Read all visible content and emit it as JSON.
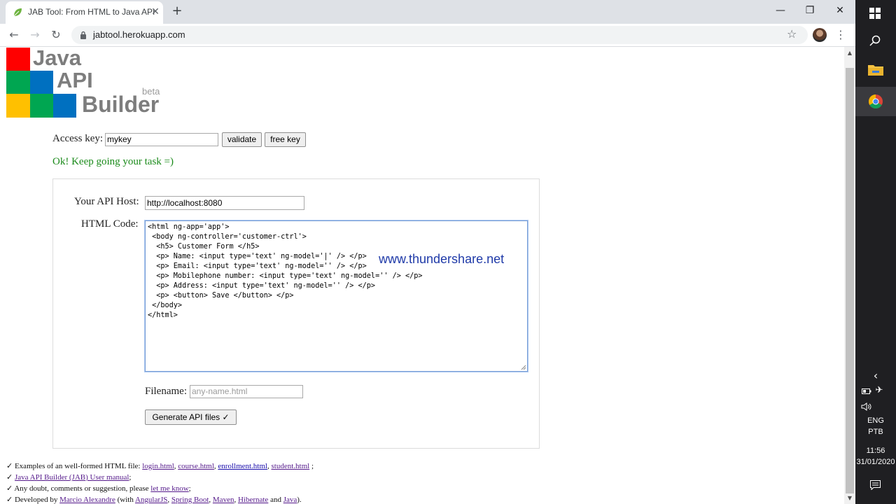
{
  "browser": {
    "tab_title": "JAB Tool: From HTML to Java API",
    "tab_close": "✕",
    "new_tab": "+",
    "url": "jabtool.herokuapp.com",
    "controls": {
      "minimize": "—",
      "restore": "❐",
      "close": "✕"
    },
    "nav": {
      "back": "←",
      "forward": "→",
      "reload": "↻"
    },
    "bookmark_star": "☆",
    "menu": "⋮"
  },
  "logo": {
    "line1": "Java",
    "line2": "API",
    "line3": "Builder",
    "beta": "beta",
    "colors": [
      "#ff0000",
      "#ffffff",
      "#00a651",
      "#0070c0",
      "#ffc000",
      "#00a651",
      "#0070c0"
    ]
  },
  "access": {
    "label": "Access key:",
    "value": "mykey",
    "validate_label": "validate",
    "free_key_label": "free key",
    "status": "Ok! Keep going your task =)"
  },
  "form": {
    "host_label": "Your API Host:",
    "host_value": "http://localhost:8080",
    "code_label": "HTML Code:",
    "code_lines": [
      "<html ng-app='app'>",
      " <body ng-controller='customer-ctrl'>",
      "  <h5> Customer Form </h5>",
      "  <p> Name: <input type='text' ng-model='|' /> </p>",
      "  <p> Email: <input type='text' ng-model='' /> </p>",
      "  <p> Mobilephone number: <input type='text' ng-model='' /> </p>",
      "  <p> Address: <input type='text' ng-model='' /> </p>",
      "  <p> <button> Save </button> </p>",
      " </body>",
      "</html>"
    ],
    "watermark": "www.thundershare.net",
    "filename_label": "Filename:",
    "filename_placeholder": "any-name.html",
    "generate_label": "Generate API files ✓"
  },
  "footer": {
    "line1_prefix": "✓ Examples of an well-formed HTML file: ",
    "line1_links": [
      "login.html",
      "course.html",
      "enrollment.html",
      "student.html"
    ],
    "line1_suffix": " ;",
    "line2_prefix": "✓ ",
    "line2_link": "Java API Builder (JAB) User manual",
    "line2_suffix": ";",
    "line3_prefix": "✓ Any doubt, comments or suggestion, please ",
    "line3_link": "let me know",
    "line3_suffix": ";",
    "line4_prefix": "✓ Developed by ",
    "line4_author": "Marcio Alexandre",
    "line4_with": " (with ",
    "line4_tech": [
      "AngularJS",
      "Spring Boot",
      "Maven",
      "Hibernate"
    ],
    "line4_and": " and ",
    "line4_java": "Java",
    "line4_suffix": ")."
  },
  "taskbar": {
    "lang1": "ENG",
    "lang2": "PTB",
    "time": "11:56",
    "date": "31/01/2020",
    "chevron": "‹"
  }
}
